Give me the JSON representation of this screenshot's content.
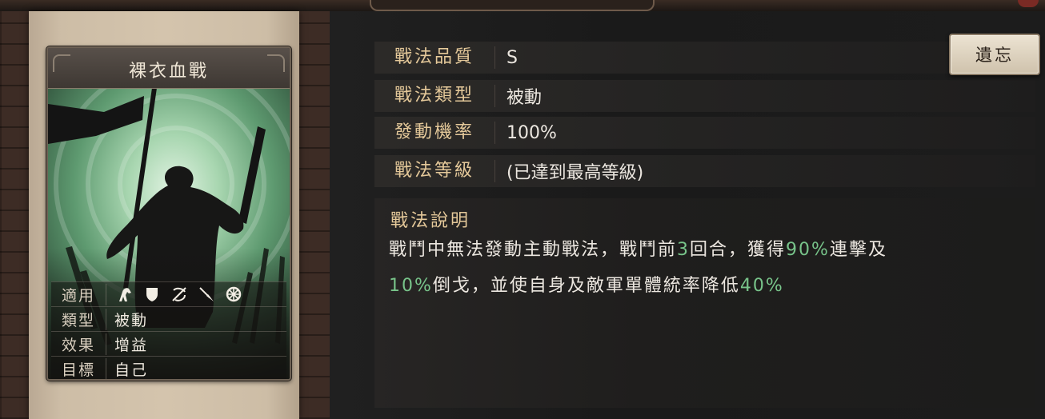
{
  "card": {
    "title": "裸衣血戰",
    "rows": [
      {
        "label": "適用",
        "troop_icons": [
          "cavalry-icon",
          "shield-icon",
          "bow-icon",
          "spear-icon",
          "siege-wheel-icon"
        ]
      },
      {
        "label": "類型",
        "value": "被動"
      },
      {
        "label": "效果",
        "value": "增益"
      },
      {
        "label": "目標",
        "value": "自己"
      }
    ]
  },
  "attributes": [
    {
      "label": "戰法品質",
      "value": "S"
    },
    {
      "label": "戰法類型",
      "value": "被動"
    },
    {
      "label": "發動機率",
      "value": "100%"
    },
    {
      "label": "戰法等級",
      "value": "(已達到最高等級)"
    }
  ],
  "description": {
    "label": "戰法說明",
    "segments": [
      {
        "text": "戰鬥中無法發動主動戰法，戰鬥前"
      },
      {
        "text": "3",
        "highlight": true
      },
      {
        "text": "回合，獲得"
      },
      {
        "text": "90%",
        "highlight": true
      },
      {
        "text": "連擊及"
      },
      {
        "break": true
      },
      {
        "text": "10%",
        "highlight": true
      },
      {
        "text": "倒戈，並使自身及敵軍單體統率降低"
      },
      {
        "text": "40%",
        "highlight": true
      }
    ]
  },
  "forget_button": "遺忘",
  "colors": {
    "highlight": "#78c48a",
    "label_gold": "#e5c99a",
    "art_green": "#5e9a70"
  }
}
